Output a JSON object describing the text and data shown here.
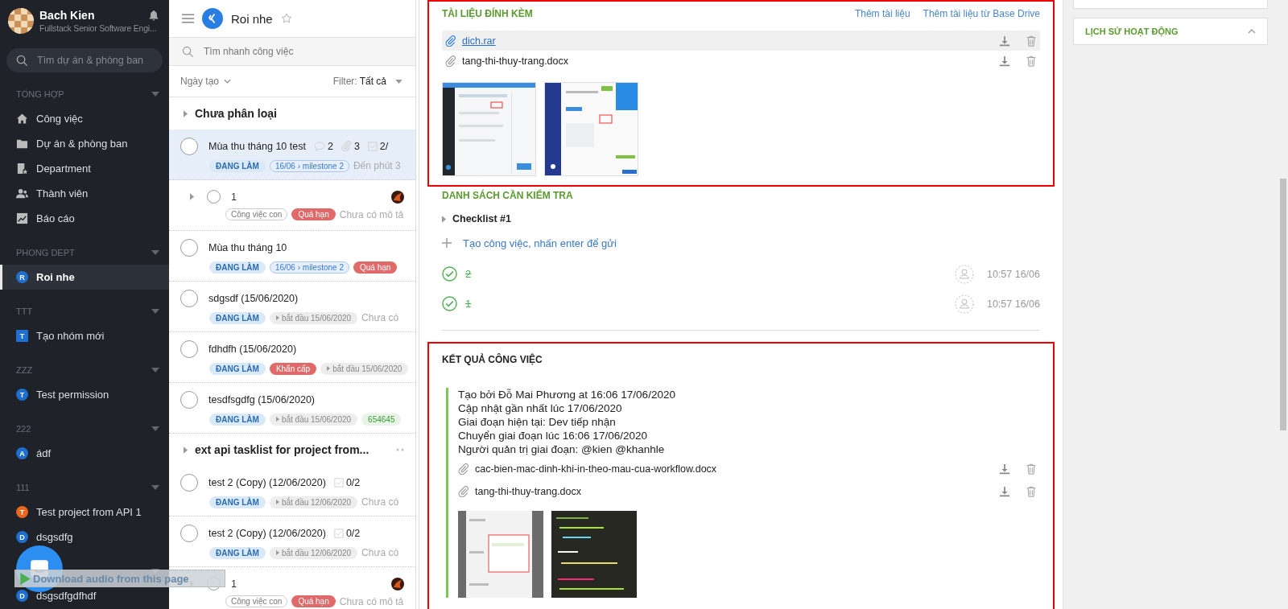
{
  "sidebar": {
    "user": {
      "name": "Bach Kien",
      "role": "Fullstack Senior Software Engi..."
    },
    "search": {
      "placeholder": "Tìm dự án & phòng ban"
    },
    "groups": [
      {
        "label": "TỔNG HỢP",
        "items": [
          {
            "label": "Công việc",
            "kind": "home",
            "selected": false
          },
          {
            "label": "Dự án & phòng ban",
            "kind": "folder",
            "selected": false
          },
          {
            "label": "Department",
            "kind": "department",
            "selected": false
          },
          {
            "label": "Thành viên",
            "kind": "members",
            "selected": false
          },
          {
            "label": "Báo cáo",
            "kind": "report",
            "selected": false
          }
        ]
      },
      {
        "label": "PHONG DEPT",
        "items": [
          {
            "label": "Roi nhe",
            "kind": "project",
            "letter": "R",
            "color": "#1e6fd0",
            "selected": true
          }
        ]
      },
      {
        "label": "TTT",
        "items": [
          {
            "label": "Tạo nhóm mới",
            "kind": "team",
            "letter": "T",
            "color": "#1e6fd0",
            "selected": false
          }
        ]
      },
      {
        "label": "ZZZ",
        "items": [
          {
            "label": "Test permission",
            "kind": "project",
            "letter": "T",
            "color": "#1e6fd0",
            "selected": false
          }
        ]
      },
      {
        "label": "222",
        "items": [
          {
            "label": "ádf",
            "kind": "project",
            "letter": "A",
            "color": "#1e6fd0",
            "selected": false
          }
        ]
      },
      {
        "label": "111",
        "items": [
          {
            "label": "Test project from API 1",
            "kind": "project",
            "letter": "T",
            "color": "#e8671e",
            "selected": false
          },
          {
            "label": "dsgsdfg",
            "kind": "project",
            "letter": "D",
            "color": "#1e6fd0",
            "selected": false
          }
        ]
      },
      {
        "items": [
          {
            "label": "dsgsdfgdfhdf",
            "kind": "project",
            "letter": "D",
            "color": "#1e6fd0",
            "selected": false
          }
        ]
      }
    ]
  },
  "overlay": {
    "audio_bar": "Download audio from this page"
  },
  "tasklist": {
    "project": {
      "name": "Roi nhe",
      "starred": false
    },
    "search": {
      "placeholder": "Tìm nhanh công việc"
    },
    "sort": "Ngày tạo",
    "filter": {
      "label": "Filter:",
      "value": "Tất cả"
    },
    "groups": [
      {
        "title": "Chưa phân loại",
        "tasks": [
          {
            "kind": "task",
            "title": "Mùa thu tháng 10 test",
            "selected": true,
            "counts": [
              {
                "kind": "comments",
                "value": "2"
              },
              {
                "kind": "attachments",
                "value": "3"
              },
              {
                "kind": "checklist",
                "value": "2/"
              }
            ],
            "tags": [
              {
                "kind": "status",
                "text": "ĐANG LÀM"
              },
              {
                "kind": "milestone",
                "text": "16/06 › milestone 2"
              }
            ],
            "note": "Đến phút 3"
          },
          {
            "kind": "subtask",
            "title": "1",
            "selected": false,
            "tags": [
              {
                "kind": "plain",
                "text": "Công việc con"
              },
              {
                "kind": "overdue",
                "text": "Quá hạn"
              }
            ],
            "note": "Chưa có mô tả"
          },
          {
            "kind": "task",
            "title": "Mùa thu tháng 10",
            "selected": false,
            "tags": [
              {
                "kind": "status",
                "text": "ĐANG LÀM"
              },
              {
                "kind": "milestone",
                "text": "16/06 › milestone 2"
              },
              {
                "kind": "overdue",
                "text": "Quá hạn"
              }
            ]
          },
          {
            "kind": "task",
            "title": "sdgsdf (15/06/2020)",
            "selected": false,
            "tags": [
              {
                "kind": "status",
                "text": "ĐANG LÀM"
              },
              {
                "kind": "start",
                "text": "bắt đầu 15/06/2020"
              }
            ],
            "note": "Chưa có"
          },
          {
            "kind": "task",
            "title": "fdhdfh (15/06/2020)",
            "selected": false,
            "tags": [
              {
                "kind": "status",
                "text": "ĐANG LÀM"
              },
              {
                "kind": "urgent",
                "text": "Khẩn cấp"
              },
              {
                "kind": "start",
                "text": "bắt đầu 15/06/2020"
              }
            ]
          },
          {
            "kind": "task",
            "title": "tesdfsgdfg (15/06/2020)",
            "selected": false,
            "tags": [
              {
                "kind": "status",
                "text": "ĐANG LÀM"
              },
              {
                "kind": "start",
                "text": "bắt đầu 15/06/2020"
              },
              {
                "kind": "label",
                "text": "654645"
              }
            ]
          }
        ]
      },
      {
        "title": "ext api tasklist for project from...",
        "tasks": [
          {
            "kind": "task",
            "title": "test 2 (Copy) (12/06/2020)",
            "selected": false,
            "counts": [
              {
                "kind": "checklist",
                "value": "0/2"
              }
            ],
            "tags": [
              {
                "kind": "status",
                "text": "ĐANG LÀM"
              },
              {
                "kind": "start",
                "text": "bắt đầu 12/06/2020"
              }
            ],
            "note": "Chưa có"
          },
          {
            "kind": "task",
            "title": "test 2 (Copy) (12/06/2020)",
            "selected": false,
            "counts": [
              {
                "kind": "checklist",
                "value": "0/2"
              }
            ],
            "tags": [
              {
                "kind": "status",
                "text": "ĐANG LÀM"
              },
              {
                "kind": "start",
                "text": "bắt đầu 12/06/2020"
              }
            ],
            "note": "Chưa có"
          },
          {
            "kind": "subtask",
            "title": "1",
            "selected": false,
            "tags": [
              {
                "kind": "plain",
                "text": "Công việc con"
              },
              {
                "kind": "overdue",
                "text": "Quá hạn"
              }
            ],
            "note": "Chưa có mô tả"
          }
        ]
      }
    ]
  },
  "attachments": {
    "title": "TÀI LIỆU ĐÍNH KÈM",
    "actions": [
      "Thêm tài liệu",
      "Thêm tài liệu từ Base Drive"
    ],
    "files": [
      {
        "name": "dich.rar",
        "selected": true
      },
      {
        "name": "tang-thi-thuy-trang.docx",
        "selected": false
      }
    ]
  },
  "checklist": {
    "title": "DANH SÁCH CẦN KIỂM TRA",
    "lists": [
      {
        "name": "Checklist #1"
      }
    ],
    "add": {
      "placeholder": "Tạo công việc, nhấn enter để gửi"
    },
    "items": [
      {
        "text": "2",
        "done": true,
        "time": "10:57 16/06"
      },
      {
        "text": "1",
        "done": true,
        "time": "10:57 16/06"
      }
    ]
  },
  "result": {
    "title": "KẾT QUẢ CÔNG VIỆC",
    "lines": [
      "Tạo bởi Đỗ Mai Phương at 16:06 17/06/2020",
      "Cập nhật gần nhất lúc 17/06/2020",
      "Giai đoạn hiện tại: Dev tiếp nhận",
      "Chuyển giai đoạn lúc 16:06 17/06/2020",
      "Người quản trị giai đoạn: @kien @khanhle"
    ],
    "files": [
      {
        "name": "cac-bien-mac-dinh-khi-in-theo-mau-cua-workflow.docx"
      },
      {
        "name": "tang-thi-thuy-trang.docx"
      }
    ]
  },
  "activity": {
    "title": "LỊCH SỬ HOẠT ĐỘNG",
    "expanded": true
  }
}
